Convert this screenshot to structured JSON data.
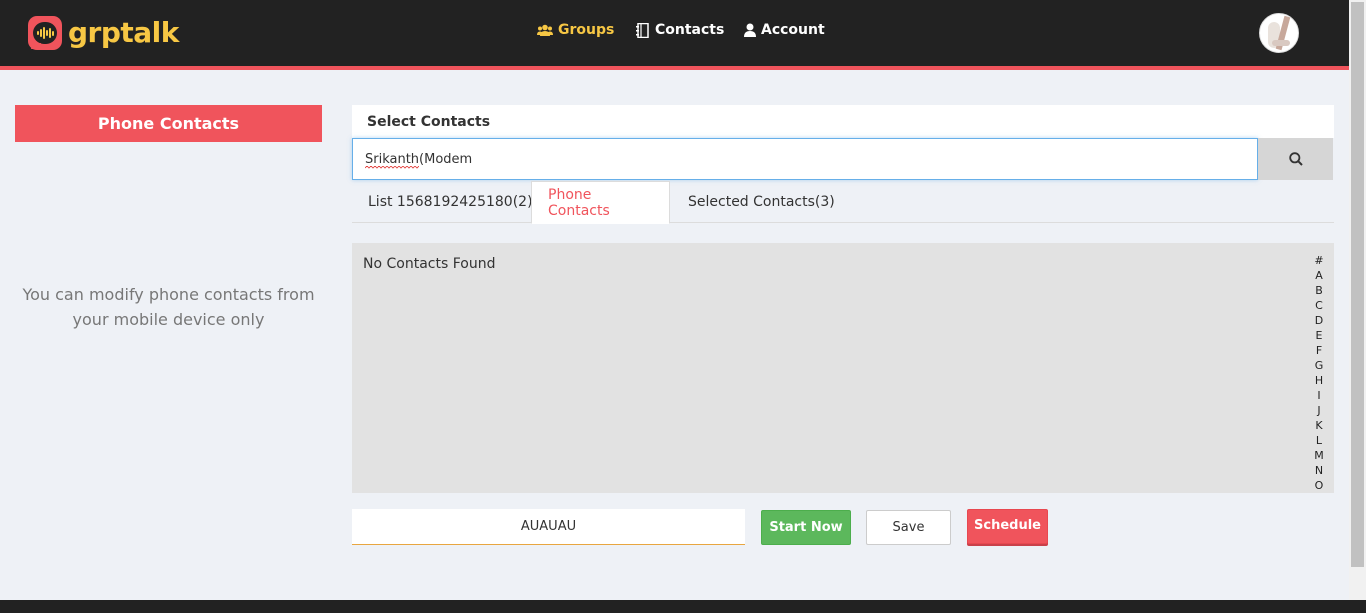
{
  "app": {
    "logo_text": "grptalk",
    "brand_color": "#f0545c",
    "accent_color": "#f7c744"
  },
  "nav": {
    "groups": "Groups",
    "contacts": "Contacts",
    "account": "Account",
    "active": "groups"
  },
  "left_panel": {
    "header": "Phone Contacts",
    "message": "You can modify phone contacts from your mobile device only"
  },
  "select_contacts": {
    "title": "Select Contacts",
    "search_value": "Srikanth(Modem"
  },
  "tabs": {
    "list": "List 1568192425180(2)",
    "phone": "Phone Contacts",
    "selected": "Selected Contacts(3)",
    "active": "phone"
  },
  "contacts_panel": {
    "empty_message": "No Contacts Found",
    "alphabet": [
      "#",
      "A",
      "B",
      "C",
      "D",
      "E",
      "F",
      "G",
      "H",
      "I",
      "J",
      "K",
      "L",
      "M",
      "N",
      "O"
    ]
  },
  "actions": {
    "group_name_value": "AUAUAU",
    "start_now": "Start Now",
    "save": "Save",
    "schedule": "Schedule"
  },
  "icons": {
    "groups": "users-icon",
    "contacts": "address-book-icon",
    "account": "user-icon",
    "search": "search-icon"
  }
}
